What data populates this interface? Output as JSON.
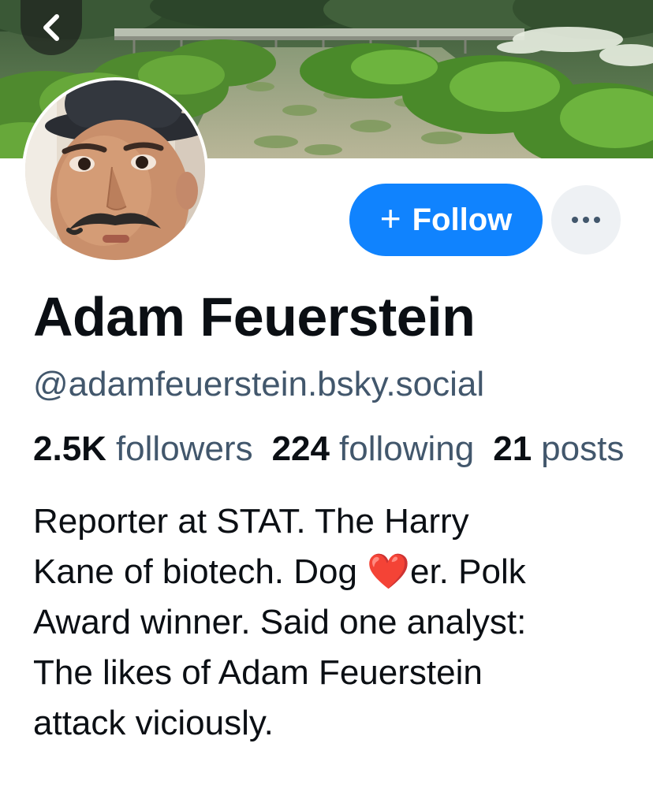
{
  "header": {
    "back_icon": "chevron-left-icon"
  },
  "profile": {
    "display_name": "Adam Feuerstein",
    "handle": "@adamfeuerstein.bsky.social",
    "follow_label": "Follow",
    "follow_icon": "plus-icon",
    "more_icon": "ellipsis-icon",
    "stats": {
      "followers_value": "2.5K",
      "followers_label": "followers",
      "following_value": "224",
      "following_label": "following",
      "posts_value": "21",
      "posts_label": "posts"
    },
    "bio_lines": {
      "line1": "Reporter at STAT. The Harry",
      "line2_before": "Kane of biotech. Dog ",
      "line2_emoji": "❤️",
      "line2_after": "er. Polk",
      "line3": "Award winner. Said one analyst:",
      "line4": "The likes of Adam Feuerstein",
      "line5": "attack viciously."
    }
  },
  "colors": {
    "accent": "#1083fe",
    "secondary_text": "#42576c",
    "primary_text": "#0b0f14",
    "more_button_bg": "#eef1f4"
  }
}
